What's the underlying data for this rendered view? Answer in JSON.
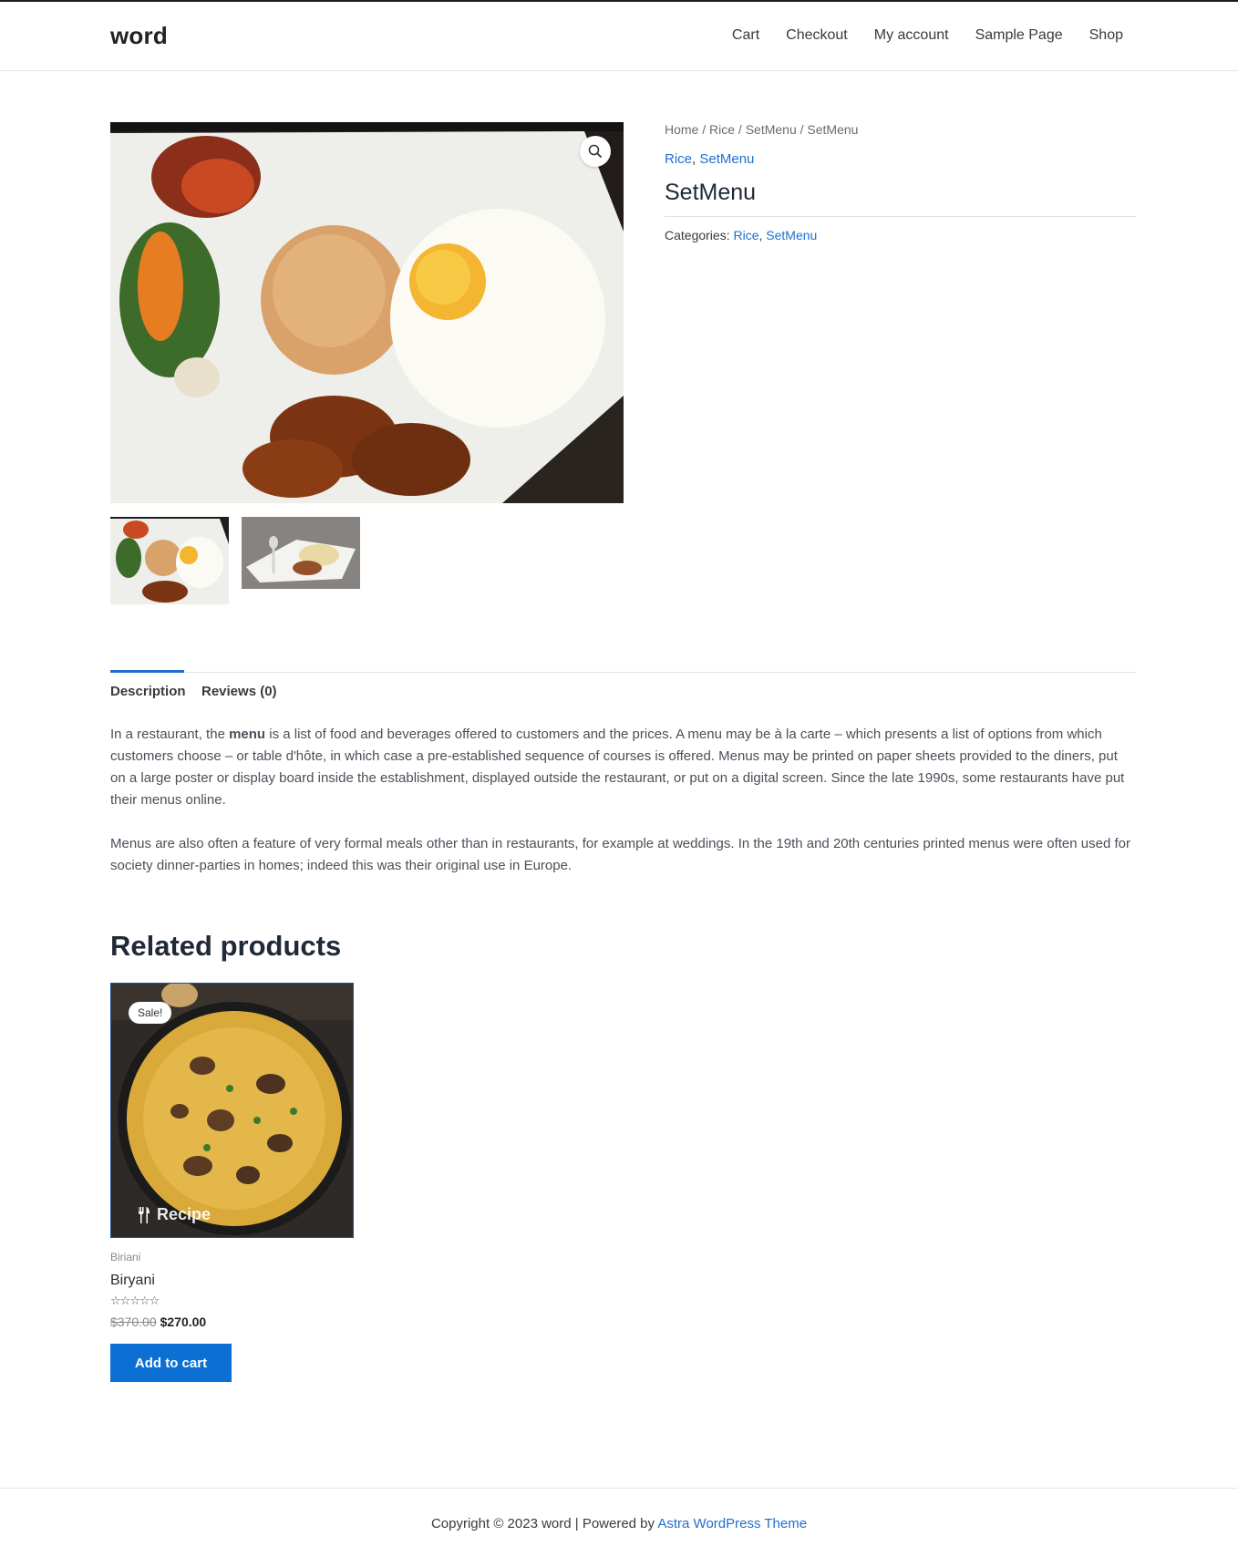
{
  "site": {
    "logo": "word"
  },
  "nav": [
    {
      "label": "Cart"
    },
    {
      "label": "Checkout"
    },
    {
      "label": "My account"
    },
    {
      "label": "Sample Page"
    },
    {
      "label": "Shop"
    }
  ],
  "gallery": {
    "zoom_icon": "magnifier-icon"
  },
  "summary": {
    "breadcrumb": "Home / Rice / SetMenu / SetMenu",
    "cat_rice": "Rice",
    "cat_sep": ", ",
    "cat_setmenu": "SetMenu",
    "title": "SetMenu",
    "meta_label": "Categories: ",
    "meta_rice": "Rice",
    "meta_setmenu": "SetMenu"
  },
  "tabs": {
    "description": "Description",
    "reviews": "Reviews (0)"
  },
  "description": {
    "p1_a": "In a restaurant, the ",
    "p1_bold": "menu",
    "p1_b": " is a list of food and beverages offered to customers and the prices. A menu may be à la carte – which presents a list of options from which customers choose – or table d'hôte, in which case a pre-established sequence of courses is offered. Menus may be printed on paper sheets provided to the diners, put on a large poster or display board inside the establishment, displayed outside the restaurant, or put on a digital screen. Since the late 1990s, some restaurants have put their menus online.",
    "p2": "Menus are also often a feature of very formal meals other than in restaurants, for example at weddings. In the 19th and 20th centuries printed menus were often used for society dinner-parties in homes; indeed this was their original use in Europe."
  },
  "related": {
    "title": "Related products",
    "sale_badge": "Sale!",
    "image_watermark": "Recipe",
    "category": "Biriani",
    "name": "Biryani",
    "rating": 0,
    "old_price": "$370.00",
    "new_price": "$270.00",
    "button": "Add to cart"
  },
  "footer": {
    "text": "Copyright © 2023 word | Powered by ",
    "link": "Astra WordPress Theme"
  },
  "colors": {
    "accent": "#1e6fce",
    "button": "#0b6fd3"
  }
}
